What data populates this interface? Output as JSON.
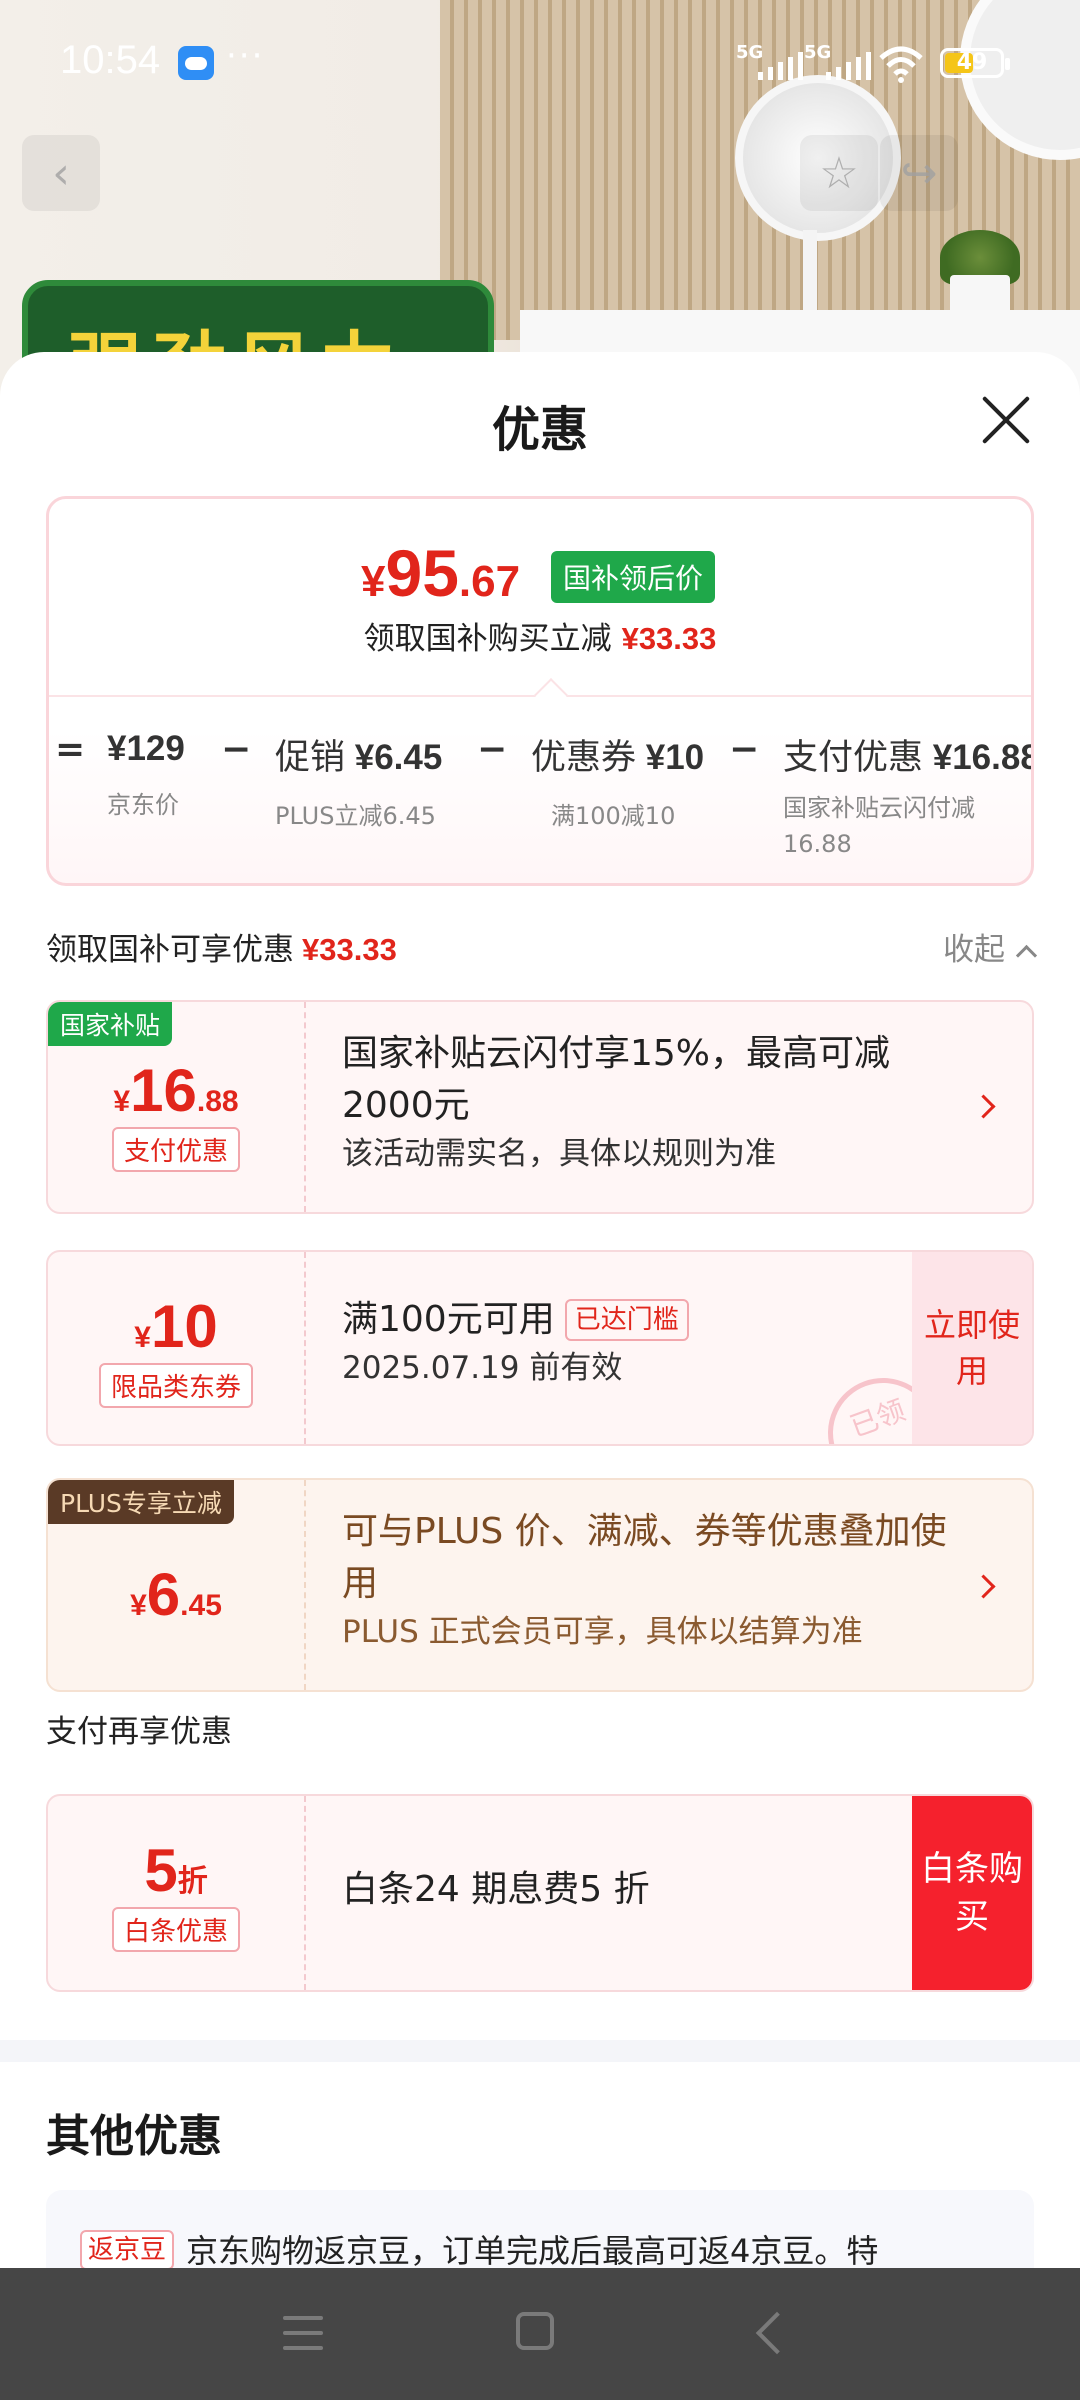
{
  "status_bar": {
    "time": "10:54",
    "dots": "···",
    "signal1": "5G",
    "signal2": "5G",
    "battery": "49"
  },
  "sheet": {
    "title": "优惠",
    "summary": {
      "currency": "¥",
      "price_int": "95",
      "price_dec": ".67",
      "price_tag": "国补领后价",
      "save_text": "领取国补购买立减",
      "save_amount": "¥33.33",
      "breakdown": [
        {
          "op": "=",
          "label": "",
          "value": "¥129",
          "sub": "京东价"
        },
        {
          "op": "−",
          "label": "促销",
          "value": "¥6.45",
          "sub": "PLUS立减6.45"
        },
        {
          "op": "−",
          "label": "优惠券",
          "value": "¥10",
          "sub": "满100减10"
        },
        {
          "op": "−",
          "label": "支付优惠",
          "value": "¥16.88",
          "sub": "国家补贴云闪付减16.88"
        }
      ]
    },
    "section_gov": {
      "label": "领取国补可享优惠",
      "amount": "¥33.33",
      "collapse": "收起"
    },
    "offers": [
      {
        "tag": "国家补贴",
        "currency": "¥",
        "amount_int": "16",
        "amount_dec": ".88",
        "pill": "支付优惠",
        "title": "国家补贴云闪付享15%，最高可减2000元",
        "subtitle": "该活动需实名，具体以规则为准"
      },
      {
        "currency": "¥",
        "amount_int": "10",
        "amount_dec": "",
        "pill": "限品类东券",
        "title": "满100元可用",
        "threshold": "已达门槛",
        "subtitle": "2025.07.19 前有效",
        "button": "立即使用",
        "stamp": "已领"
      },
      {
        "tag": "PLUS专享立减",
        "currency": "¥",
        "amount_int": "6",
        "amount_dec": ".45",
        "title": "可与PLUS 价、满减、券等优惠叠加使用",
        "subtitle": "PLUS 正式会员可享，具体以结算为准"
      }
    ],
    "section_pay": {
      "label": "支付再享优惠"
    },
    "baitiao": {
      "amount": "5",
      "unit": "折",
      "pill": "白条优惠",
      "title": "白条24 期息费5 折",
      "button": "白条购买"
    },
    "other": {
      "title": "其他优惠",
      "tag": "返京豆",
      "text": "京东购物返京豆，订单完成后最高可返4京豆。特"
    }
  },
  "background": {
    "banner_text": "强劲风力"
  },
  "colors": {
    "accent_red": "#e1251b",
    "gov_green": "#1fa84a",
    "plus_brown": "#5a3a26",
    "baitiao_red": "#f5212d"
  }
}
